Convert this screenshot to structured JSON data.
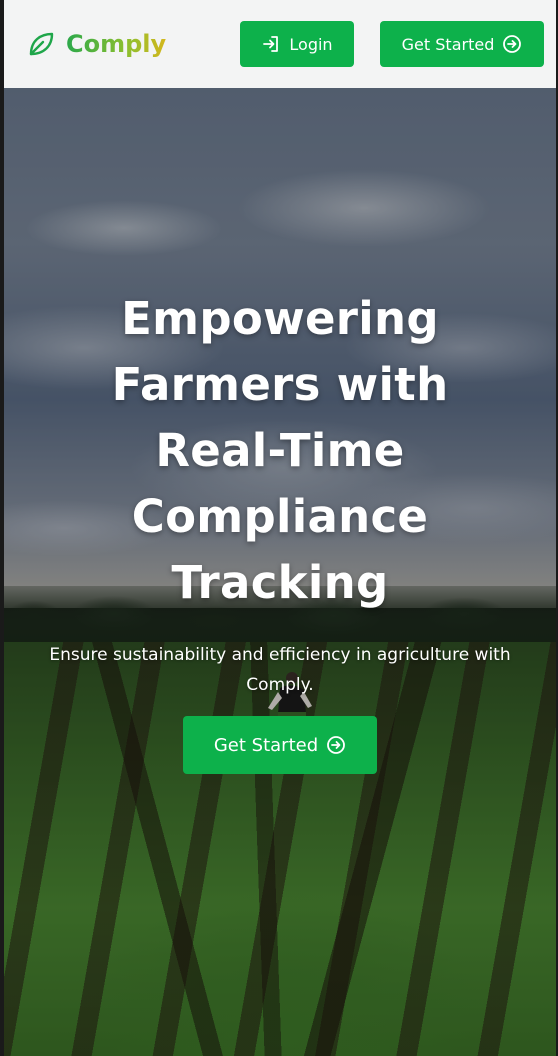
{
  "header": {
    "brand": "Comply",
    "login_label": "Login",
    "get_started_label": "Get Started"
  },
  "hero": {
    "title": "Empowering Farmers with Real-Time Compliance Tracking",
    "subtitle": "Ensure sustainability and efficiency in agriculture with Comply.",
    "cta_label": "Get Started"
  },
  "icons": {
    "brand": "leaf-icon",
    "login": "login-arrow-icon",
    "get_started": "circle-arrow-right-icon"
  },
  "colors": {
    "primary_button": "#0db14b",
    "header_background": "#f3f4f4",
    "brand_gradient_start": "#2aa84a",
    "brand_gradient_end": "#d4b71c",
    "hero_text": "#ffffff"
  }
}
